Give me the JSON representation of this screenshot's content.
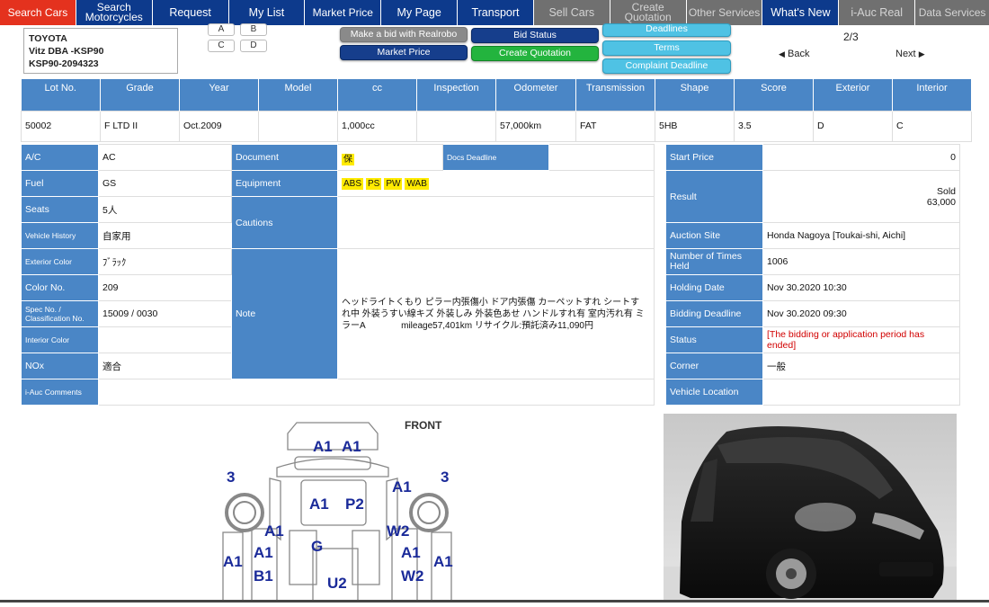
{
  "nav": [
    {
      "label": "Search Cars",
      "state": "active"
    },
    {
      "label": "Search Motorcycles",
      "state": "normal"
    },
    {
      "label": "Request",
      "state": "normal"
    },
    {
      "label": "My List",
      "state": "normal"
    },
    {
      "label": "Market Price",
      "state": "normal"
    },
    {
      "label": "My Page",
      "state": "normal"
    },
    {
      "label": "Transport",
      "state": "normal"
    },
    {
      "label": "Sell Cars",
      "state": "disabled"
    },
    {
      "label": "Create Quotation",
      "state": "disabled"
    },
    {
      "label": "Other Services",
      "state": "disabled"
    },
    {
      "label": "What's New",
      "state": "normal"
    },
    {
      "label": "i-Auc Real",
      "state": "disabled"
    },
    {
      "label": "Data Services",
      "state": "disabled"
    }
  ],
  "vehicle": {
    "make": "TOYOTA",
    "model": "Vitz DBA -KSP90",
    "chassis": "KSP90-2094323"
  },
  "letters": [
    "A",
    "B",
    "C",
    "D"
  ],
  "actions": {
    "bid_realrobo": "Make a bid with Realrobo",
    "market_price": "Market Price",
    "bid_status": "Bid Status",
    "create_quotation": "Create Quotation",
    "deadlines": "Deadlines",
    "terms": "Terms",
    "complaint_deadline": "Complaint Deadline"
  },
  "pager": {
    "position": "2/3",
    "back": "Back",
    "next": "Next"
  },
  "lot_table": {
    "headers": [
      "Lot No.",
      "Grade",
      "Year",
      "Model",
      "cc",
      "Inspection",
      "Odometer",
      "Transmission",
      "Shape",
      "Score",
      "Exterior",
      "Interior"
    ],
    "row": [
      "50002",
      "F LTD II",
      "Oct.2009",
      "",
      "1,000cc",
      "",
      "57,000km",
      "FAT",
      "5HB",
      "3.5",
      "D",
      "C"
    ]
  },
  "specs": [
    {
      "label": "A/C",
      "value": "AC"
    },
    {
      "label": "Fuel",
      "value": "GS"
    },
    {
      "label": "Seats",
      "value": "5人"
    },
    {
      "label": "Vehicle History",
      "value": "自家用"
    },
    {
      "label": "Exterior Color",
      "value": "ﾌﾞﾗｯｸ"
    },
    {
      "label": "Color No.",
      "value": "209"
    },
    {
      "label": "Spec No. / Classification No.",
      "value": "15009 / 0030"
    },
    {
      "label": "Interior Color",
      "value": ""
    },
    {
      "label": "NOx",
      "value": "適合"
    },
    {
      "label": "i-Auc Comments",
      "value": ""
    }
  ],
  "document": {
    "label": "Document",
    "badge": "保",
    "docs_deadline_label": "Docs Deadline",
    "docs_deadline_value": ""
  },
  "equipment": {
    "label": "Equipment",
    "items": [
      "ABS",
      "PS",
      "PW",
      "WAB"
    ]
  },
  "cautions": {
    "label": "Cautions",
    "value": ""
  },
  "note": {
    "label": "Note",
    "text": "ヘッドライトくもり ピラー内張傷小 ドア内張傷 カーペットすれ シートすれ中 外装うすい線キズ 外装しみ 外装色あせ ハンドルすれ有 室内汚れ有 ミラーA　　　　mileage57,401km リサイクル:預託済み11,090円"
  },
  "auction": {
    "start_price_label": "Start Price",
    "start_price": "0",
    "result_label": "Result",
    "result_status": "Sold",
    "result_price": "63,000",
    "site_label": "Auction Site",
    "site": "Honda Nagoya [Toukai-shi, Aichi]",
    "times_label": "Number of Times Held",
    "times": "1006",
    "holding_label": "Holding Date",
    "holding": "Nov 30.2020 10:30",
    "bidding_label": "Bidding Deadline",
    "bidding": "Nov 30.2020 09:30",
    "status_label": "Status",
    "status": "[The bidding or application period has ended]",
    "corner_label": "Corner",
    "corner": "一般",
    "location_label": "Vehicle Location",
    "location": ""
  },
  "inspection_map": {
    "front_label": "FRONT",
    "marks": [
      "A1",
      "A1",
      "3",
      "A1",
      "P2",
      "3",
      "A1",
      "W2",
      "A1",
      "G",
      "A1",
      "A1",
      "B1",
      "U2",
      "W2",
      "A1"
    ]
  },
  "colors": {
    "nav": "#0d3a8c",
    "nav_active": "#e4321e",
    "header_blue": "#4a86c6",
    "status_red": "#d10000"
  }
}
